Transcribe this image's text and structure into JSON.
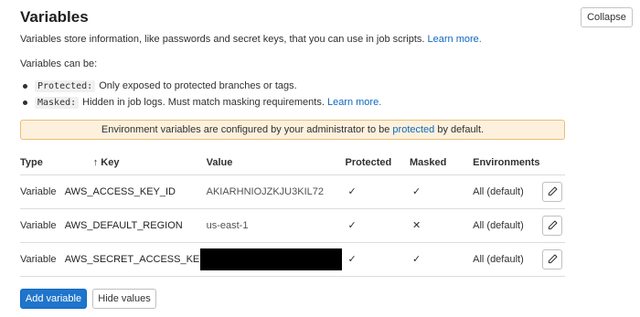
{
  "header": {
    "title": "Variables",
    "collapse_label": "Collapse"
  },
  "description": {
    "text": "Variables store information, like passwords and secret keys, that you can use in job scripts.",
    "link": "Learn more."
  },
  "can_be": {
    "intro": "Variables can be:",
    "items": [
      {
        "code": "Protected:",
        "text": "Only exposed to protected branches or tags.",
        "link": ""
      },
      {
        "code": "Masked:",
        "text": "Hidden in job logs. Must match masking requirements.",
        "link": "Learn more."
      }
    ]
  },
  "alert": {
    "before": "Environment variables are configured by your administrator to be",
    "link": "protected",
    "after": "by default."
  },
  "table": {
    "columns": {
      "type": "Type",
      "sort_arrow": "↑",
      "key": "Key",
      "value": "Value",
      "protected": "Protected",
      "masked": "Masked",
      "environments": "Environments"
    },
    "rows": [
      {
        "type": "Variable",
        "key": "AWS_ACCESS_KEY_ID",
        "value": "AKIARHNIOJZKJU3KIL72",
        "protected": "✓",
        "masked": "✓",
        "environments": "All (default)",
        "value_redacted": false
      },
      {
        "type": "Variable",
        "key": "AWS_DEFAULT_REGION",
        "value": "us-east-1",
        "protected": "✓",
        "masked": "✕",
        "environments": "All (default)",
        "value_redacted": false
      },
      {
        "type": "Variable",
        "key": "AWS_SECRET_ACCESS_KEY",
        "value": "",
        "protected": "✓",
        "masked": "✓",
        "environments": "All (default)",
        "value_redacted": true
      }
    ]
  },
  "actions": {
    "add_label": "Add variable",
    "hide_label": "Hide values"
  },
  "colors": {
    "link": "#1068bf",
    "primary_button": "#1f75cb",
    "alert_bg": "#fdf1dd",
    "alert_border": "#e9be74"
  },
  "icons": {
    "edit": "pencil-icon",
    "check": "check-icon",
    "cross": "close-icon"
  }
}
